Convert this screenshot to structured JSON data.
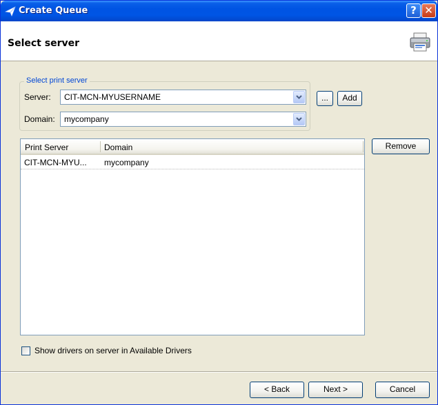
{
  "window": {
    "title": "Create Queue",
    "help_label": "?",
    "close_label": "✕"
  },
  "header": {
    "title": "Select server"
  },
  "server_group": {
    "legend": "Select print server",
    "server_label": "Server:",
    "server_value": "CIT-MCN-MYUSERNAME",
    "domain_label": "Domain:",
    "domain_value": "mycompany",
    "browse_label": "...",
    "add_label": "Add"
  },
  "server_list": {
    "columns": [
      "Print Server",
      "Domain"
    ],
    "rows": [
      {
        "print_server": "CIT-MCN-MYU...",
        "domain": "mycompany"
      }
    ],
    "remove_label": "Remove"
  },
  "options": {
    "show_drivers_label": "Show drivers on server in Available Drivers",
    "show_drivers_checked": false
  },
  "footer": {
    "back_label": "< Back",
    "next_label": "Next >",
    "cancel_label": "Cancel"
  }
}
